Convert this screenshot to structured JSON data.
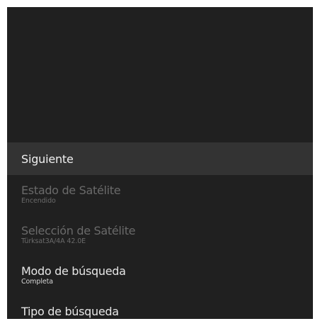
{
  "menu": {
    "items": [
      {
        "label": "Siguiente",
        "state": "selected"
      },
      {
        "label": "Estado de Satélite",
        "value": "Encendido",
        "state": "disabled"
      },
      {
        "label": "Selección de Satélite",
        "value": "Türksat3A/4A 42.0E",
        "state": "disabled"
      },
      {
        "label": "Modo de búsqueda",
        "value": "Completa",
        "state": "enabled"
      },
      {
        "label": "Tipo de búsqueda",
        "state": "enabled"
      }
    ]
  },
  "colors": {
    "background": "#202020",
    "selected_row": "#333333",
    "text_enabled": "#e6e6e6",
    "text_disabled": "#6a6a6a"
  }
}
